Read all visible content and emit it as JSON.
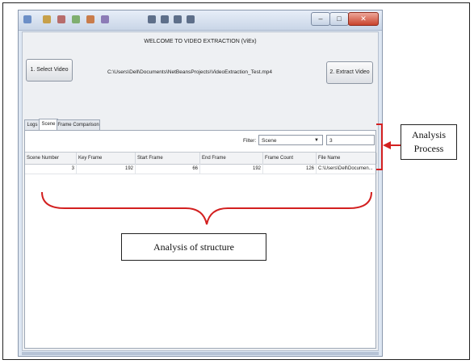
{
  "window": {
    "buttons": {
      "minimize": "–",
      "maximize": "□",
      "close": "✕"
    },
    "welcome_text": "WELCOME TO VIDEO EXTRACTION (ViEx)",
    "select_button": "1. Select Video",
    "extract_button": "2. Extract Video",
    "file_path": "C:\\Users\\Dell\\Documents\\NetBeansProjects\\VideoExtraction_Test.mp4"
  },
  "tabs": [
    {
      "label": "Logs"
    },
    {
      "label": "Scene"
    },
    {
      "label": "Frame Comparison"
    }
  ],
  "filter": {
    "label": "Filter:",
    "selected": "Scene",
    "value": "3"
  },
  "table": {
    "columns": [
      "Scene Number",
      "Key Frame",
      "Start Frame",
      "End Frame",
      "Frame Count",
      "File Name"
    ],
    "rows": [
      [
        "3",
        "192",
        "66",
        "192",
        "126",
        "C:\\Users\\Dell\\Documen..."
      ]
    ]
  },
  "annotations": {
    "analysis_process": "Analysis Process",
    "analysis_structure": "Analysis of structure"
  }
}
